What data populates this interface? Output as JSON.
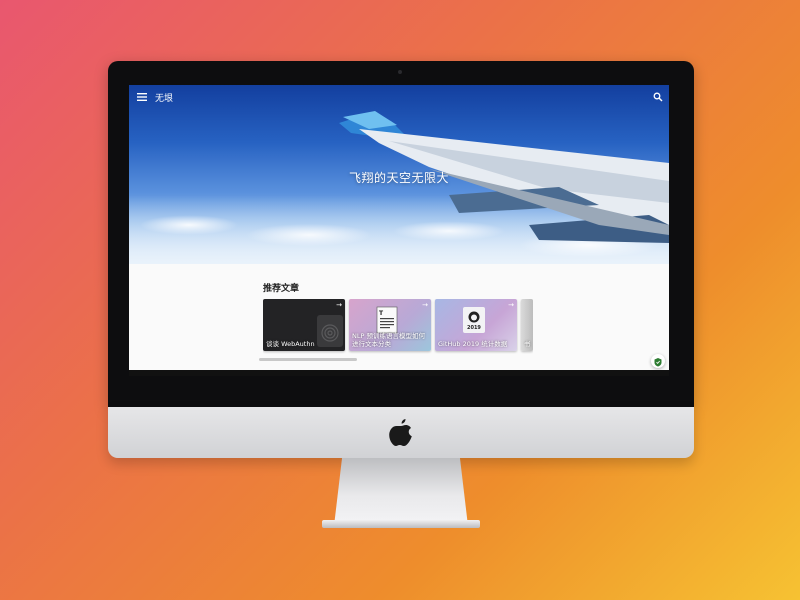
{
  "header": {
    "brand": "无垠",
    "menu_icon": "menu-icon",
    "search_icon": "search-icon"
  },
  "hero": {
    "title": "飞翔的天空无限大"
  },
  "recommended": {
    "title": "推荐文章",
    "cards": [
      {
        "label": "谈谈 WebAuthn",
        "icon": "fingerprint-icon"
      },
      {
        "label": "NLP 预训练语言模型如何进行文本分类",
        "icon": "document-icon"
      },
      {
        "label": "GitHub 2019 统计数据",
        "icon": "github-icon",
        "badge": "2019"
      },
      {
        "label": "书"
      }
    ]
  },
  "colors": {
    "accent": "#2e7d32",
    "card_dark": "#232325"
  }
}
